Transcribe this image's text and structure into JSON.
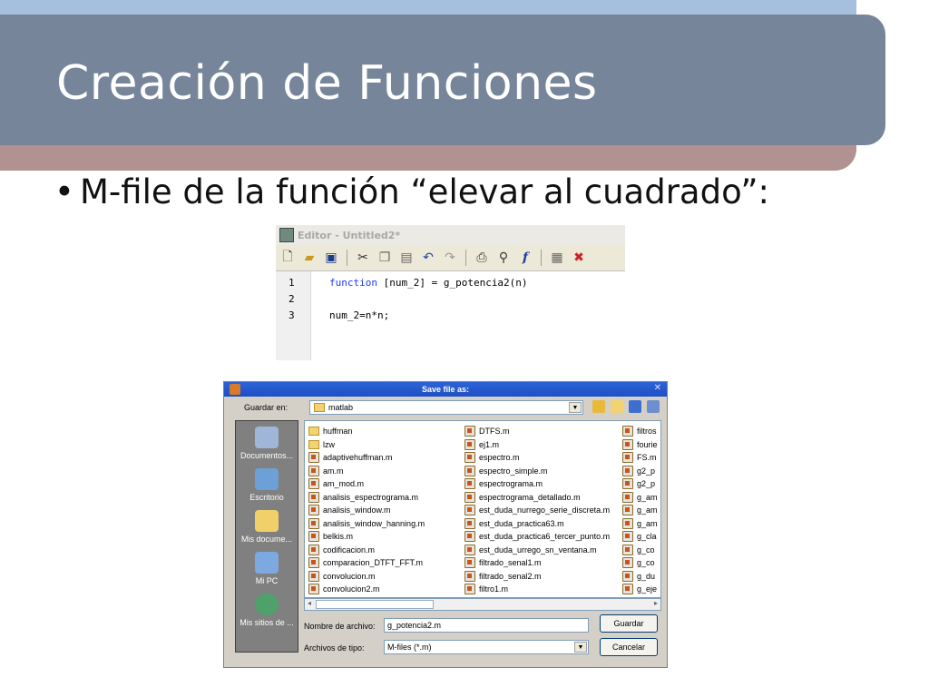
{
  "slide": {
    "title": "Creación de Funciones",
    "bullet": "M-file de la función “elevar al cuadrado”:"
  },
  "editor": {
    "window_title": "Editor - Untitled2*",
    "lines": [
      {
        "num": "1",
        "keyword": "function",
        "rest": " [num_2] = g_potencia2(n)"
      },
      {
        "num": "2",
        "keyword": "",
        "rest": ""
      },
      {
        "num": "3",
        "keyword": "",
        "rest": "num_2=n*n;"
      }
    ],
    "toolbar_icons": [
      "new-file-icon",
      "open-folder-icon",
      "save-icon",
      "cut-icon",
      "copy-icon",
      "paste-icon",
      "undo-icon",
      "redo-icon",
      "print-icon",
      "find-icon",
      "function-icon",
      "stack-icon",
      "clear-breakpoints-icon"
    ]
  },
  "dialog": {
    "title": "Save file as:",
    "look_in_label": "Guardar en:",
    "look_in_value": "matlab",
    "places": [
      "Documentos...",
      "Escritorio",
      "Mis docume...",
      "Mi PC",
      "Mis sitios de ..."
    ],
    "columns": [
      [
        {
          "name": "huffman",
          "type": "folder"
        },
        {
          "name": "lzw",
          "type": "folder"
        },
        {
          "name": "adaptivehuffman.m",
          "type": "m"
        },
        {
          "name": "am.m",
          "type": "m"
        },
        {
          "name": "am_mod.m",
          "type": "m"
        },
        {
          "name": "analisis_espectrograma.m",
          "type": "m"
        },
        {
          "name": "analisis_window.m",
          "type": "m"
        },
        {
          "name": "analisis_window_hanning.m",
          "type": "m"
        },
        {
          "name": "belkis.m",
          "type": "m"
        },
        {
          "name": "codificacion.m",
          "type": "m"
        },
        {
          "name": "comparacion_DTFT_FFT.m",
          "type": "m"
        },
        {
          "name": "convolucion.m",
          "type": "m"
        },
        {
          "name": "convolucion2.m",
          "type": "m"
        }
      ],
      [
        {
          "name": "DTFS.m",
          "type": "m"
        },
        {
          "name": "ej1.m",
          "type": "m"
        },
        {
          "name": "espectro.m",
          "type": "m"
        },
        {
          "name": "espectro_simple.m",
          "type": "m"
        },
        {
          "name": "espectrograma.m",
          "type": "m"
        },
        {
          "name": "espectrograma_detallado.m",
          "type": "m"
        },
        {
          "name": "est_duda_nurrego_serie_discreta.m",
          "type": "m"
        },
        {
          "name": "est_duda_practica63.m",
          "type": "m"
        },
        {
          "name": "est_duda_practica6_tercer_punto.m",
          "type": "m"
        },
        {
          "name": "est_duda_urrego_sn_ventana.m",
          "type": "m"
        },
        {
          "name": "filtrado_senal1.m",
          "type": "m"
        },
        {
          "name": "filtrado_senal2.m",
          "type": "m"
        },
        {
          "name": "filtro1.m",
          "type": "m"
        }
      ],
      [
        {
          "name": "filtros",
          "type": "m"
        },
        {
          "name": "fourie",
          "type": "m"
        },
        {
          "name": "FS.m",
          "type": "m"
        },
        {
          "name": "g2_p",
          "type": "m"
        },
        {
          "name": "g2_p",
          "type": "m"
        },
        {
          "name": "g_am",
          "type": "m"
        },
        {
          "name": "g_am",
          "type": "m"
        },
        {
          "name": "g_am",
          "type": "m"
        },
        {
          "name": "g_cla",
          "type": "m"
        },
        {
          "name": "g_co",
          "type": "m"
        },
        {
          "name": "g_co",
          "type": "m"
        },
        {
          "name": "g_du",
          "type": "m"
        },
        {
          "name": "g_eje",
          "type": "m"
        }
      ]
    ],
    "filename_label": "Nombre de archivo:",
    "filename_value": "g_potencia2.m",
    "filetype_label": "Archivos de tipo:",
    "filetype_value": "M-files (*.m)",
    "save_button": "Guardar",
    "cancel_button": "Cancelar"
  }
}
